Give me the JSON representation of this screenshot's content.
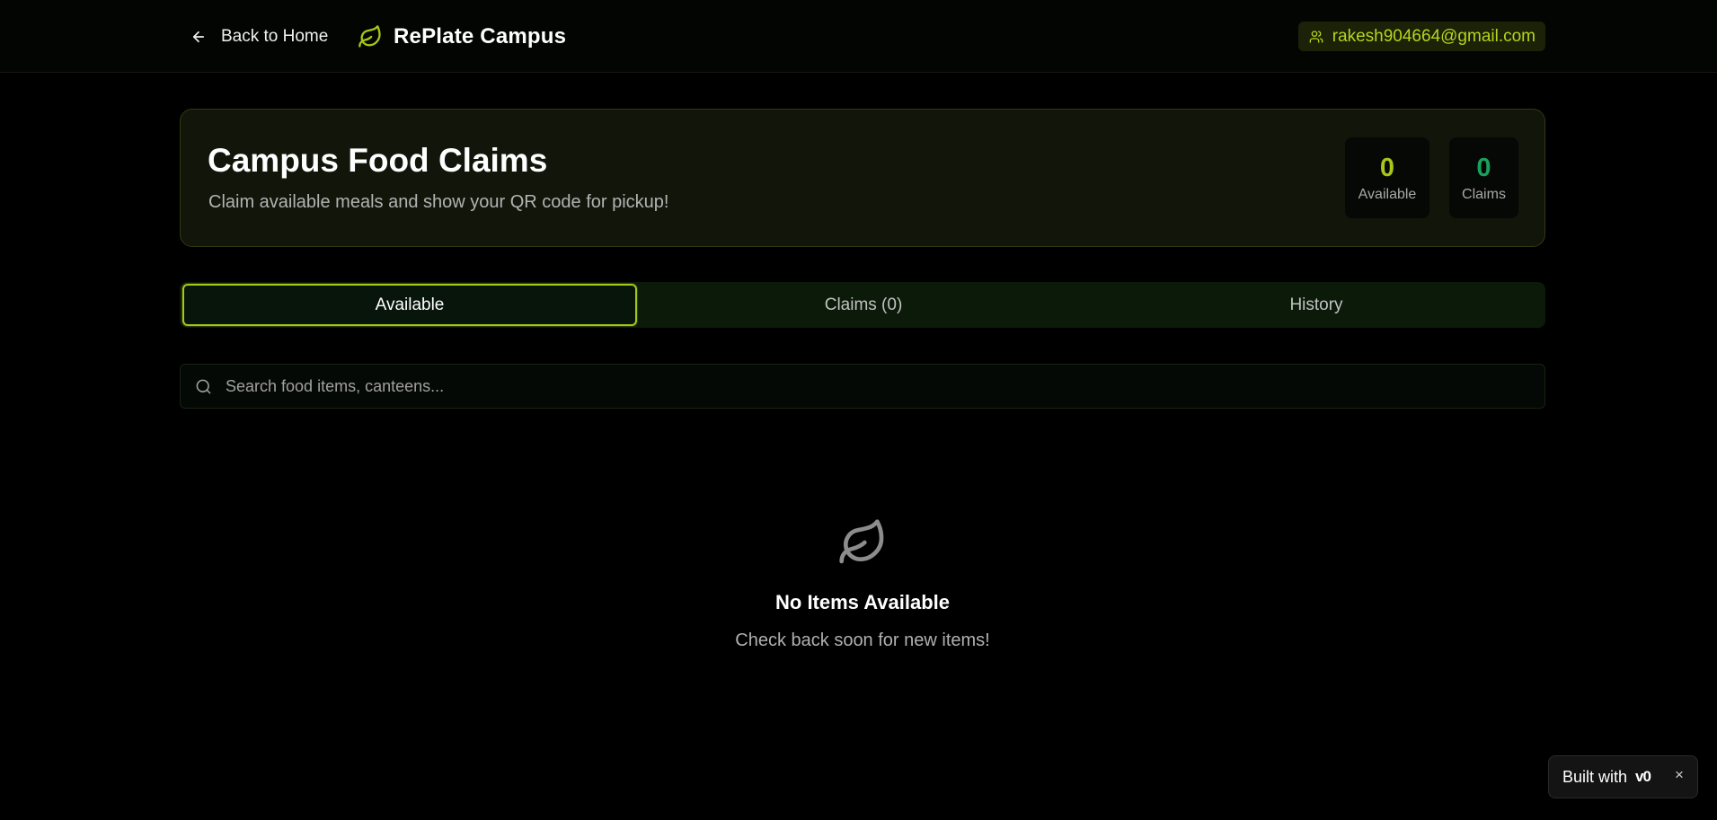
{
  "header": {
    "back_label": "Back to Home",
    "brand_name": "RePlate Campus",
    "user_email": "rakesh904664@gmail.com"
  },
  "hero": {
    "title": "Campus Food Claims",
    "subtitle": "Claim available meals and show your QR code for pickup!",
    "stats": {
      "available": {
        "value": "0",
        "label": "Available"
      },
      "claims": {
        "value": "0",
        "label": "Claims"
      }
    }
  },
  "tabs": [
    {
      "label": "Available",
      "active": true
    },
    {
      "label": "Claims (0)",
      "active": false
    },
    {
      "label": "History",
      "active": false
    }
  ],
  "search": {
    "value": "",
    "placeholder": "Search food items, canteens..."
  },
  "empty_state": {
    "icon": "leaf-icon",
    "title": "No Items Available",
    "subtitle": "Check back soon for new items!"
  },
  "badge": {
    "text": "Built with",
    "logo": "v0",
    "close": "×"
  },
  "colors": {
    "accent": "#a6c716",
    "claims_accent": "#18a05e",
    "background": "#000000"
  }
}
